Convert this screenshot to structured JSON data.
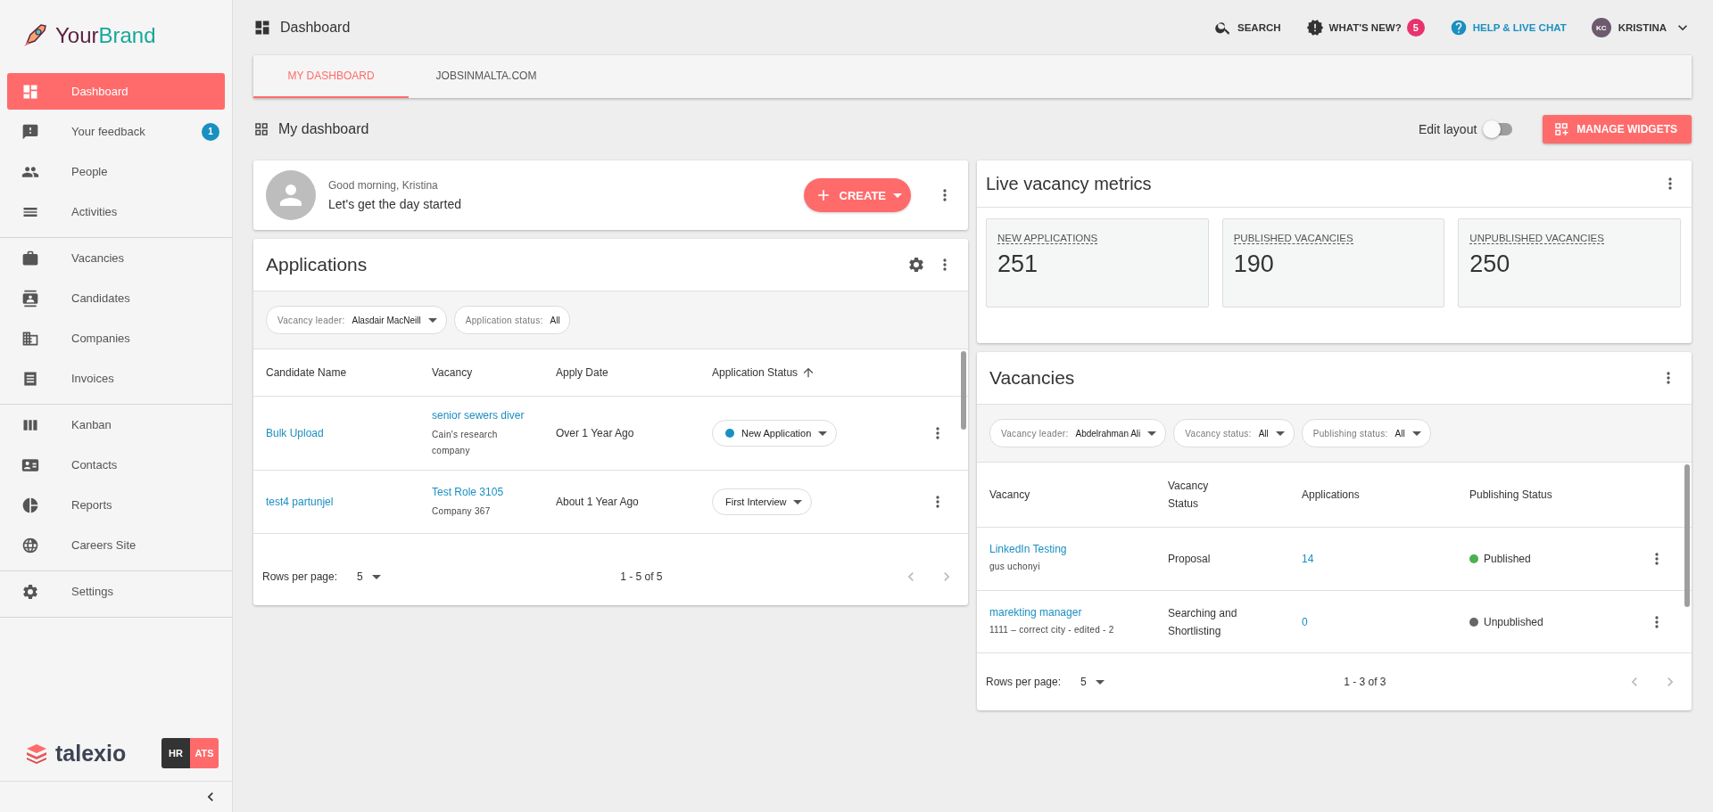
{
  "brand": {
    "text_1": "Your",
    "text_2": "Brand"
  },
  "sidebar": {
    "groups": [
      [
        {
          "label": "Dashboard",
          "selected": true
        },
        {
          "label": "Your feedback",
          "selected": false,
          "badge": "1"
        },
        {
          "label": "People",
          "selected": false
        },
        {
          "label": "Activities",
          "selected": false
        }
      ],
      [
        {
          "label": "Vacancies",
          "selected": false
        },
        {
          "label": "Candidates",
          "selected": false
        },
        {
          "label": "Companies",
          "selected": false
        },
        {
          "label": "Invoices",
          "selected": false
        }
      ],
      [
        {
          "label": "Kanban",
          "selected": false
        },
        {
          "label": "Contacts",
          "selected": false
        },
        {
          "label": "Reports",
          "selected": false
        },
        {
          "label": "Careers Site",
          "selected": false
        }
      ],
      [
        {
          "label": "Settings",
          "selected": false
        }
      ]
    ],
    "product": "talexio",
    "modules": [
      {
        "label": "HR",
        "selected": false
      },
      {
        "label": "ATS",
        "selected": true
      }
    ]
  },
  "topbar": {
    "title": "Dashboard",
    "actions": [
      {
        "label": "SEARCH",
        "kind": "search"
      },
      {
        "label": "WHAT'S NEW?",
        "kind": "news",
        "badge": "5"
      },
      {
        "label": "HELP & LIVE CHAT",
        "kind": "help"
      }
    ],
    "user": {
      "initials": "KC",
      "name": "KRISTINA"
    }
  },
  "tabs": [
    {
      "label": "MY DASHBOARD",
      "selected": true
    },
    {
      "label": "JOBSINMALTA.COM",
      "selected": false
    }
  ],
  "dashboard": {
    "title": "My dashboard",
    "edit_layout": {
      "label": "Edit layout",
      "on": false
    },
    "manage_button": "MANAGE WIDGETS"
  },
  "greeting": {
    "greeting": "Good morning, Kristina",
    "message": "Let's get the day started",
    "create_button": "CREATE"
  },
  "applications": {
    "title": "Applications",
    "filters": [
      {
        "label": "Vacancy leader:",
        "value": "Alasdair MacNeill",
        "dropdown": true
      },
      {
        "label": "Application status:",
        "value": "All",
        "dropdown": false
      }
    ],
    "columns": [
      {
        "label": "Candidate Name",
        "sorted": false
      },
      {
        "label": "Vacancy",
        "sorted": false
      },
      {
        "label": "Apply Date",
        "sorted": false
      },
      {
        "label": "Application Status",
        "sorted": true
      }
    ],
    "rows": [
      {
        "candidate": "Bulk Upload",
        "vacancy": "senior sewers diver",
        "company": "Cain's research company",
        "apply_date": "Over 1 Year Ago",
        "status": {
          "label": "New Application",
          "color": "#1a8fc1"
        }
      },
      {
        "candidate": "test4 partunjel",
        "vacancy": "Test Role 3105",
        "company": "Company 367",
        "apply_date": "About 1 Year Ago",
        "status": {
          "label": "First Interview"
        }
      }
    ],
    "pagination": {
      "rows_per_page_label": "Rows per page:",
      "rows_per_page": "5",
      "range": "1 - 5 of 5"
    }
  },
  "metrics": {
    "title": "Live vacancy metrics",
    "tiles": [
      {
        "label": "NEW APPLICATIONS",
        "value": "251"
      },
      {
        "label": "PUBLISHED VACANCIES",
        "value": "190"
      },
      {
        "label": "UNPUBLISHED VACANCIES",
        "value": "250"
      }
    ]
  },
  "vacancies": {
    "title": "Vacancies",
    "filters": [
      {
        "label": "Vacancy leader:",
        "value": "Abdelrahman Ali",
        "dropdown": true
      },
      {
        "label": "Vacancy status:",
        "value": "All",
        "dropdown": true
      },
      {
        "label": "Publishing status:",
        "value": "All",
        "dropdown": true
      }
    ],
    "columns": [
      "Vacancy",
      "Vacancy Status",
      "Applications",
      "Publishing Status"
    ],
    "rows": [
      {
        "vacancy": "LinkedIn Testing",
        "detail": "gus uchonyi",
        "status": "Proposal",
        "applications": "14",
        "publishing": {
          "label": "Published",
          "color": "#4caf50"
        }
      },
      {
        "vacancy": "marekting manager",
        "detail": "1111 – correct city - edited - 2",
        "status": "Searching and Shortlisting",
        "applications": "0",
        "publishing": {
          "label": "Unpublished",
          "color": "#666666"
        }
      }
    ],
    "pagination": {
      "rows_per_page_label": "Rows per page:",
      "rows_per_page": "5",
      "range": "1 - 3 of 3"
    }
  }
}
